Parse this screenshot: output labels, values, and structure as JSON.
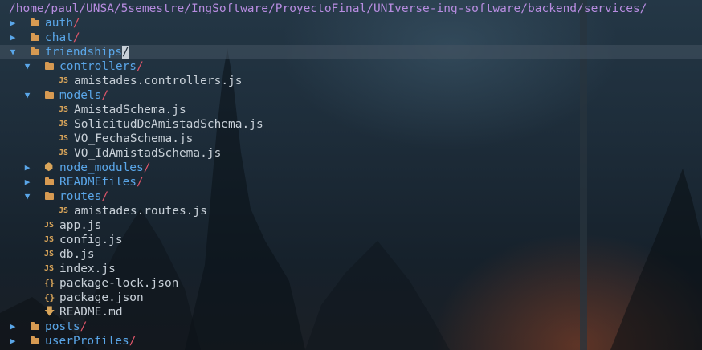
{
  "terminal": {
    "path": "/home/paul/UNSA/5semestre/IngSoftware/ProyectoFinal/UNIverse-ing-software/backend/services/",
    "tree": [
      {
        "name": "auth",
        "kind": "dir",
        "depth": 0,
        "expanded": false,
        "icon": "folder-icon"
      },
      {
        "name": "chat",
        "kind": "dir",
        "depth": 0,
        "expanded": false,
        "icon": "folder-icon"
      },
      {
        "name": "friendships",
        "kind": "dir",
        "depth": 0,
        "expanded": true,
        "icon": "folder-icon",
        "selected": true
      },
      {
        "name": "controllers",
        "kind": "dir",
        "depth": 1,
        "expanded": true,
        "icon": "folder-icon"
      },
      {
        "name": "amistades.controllers.js",
        "kind": "file",
        "depth": 2,
        "icon": "js-icon",
        "icon_text": "JS"
      },
      {
        "name": "models",
        "kind": "dir",
        "depth": 1,
        "expanded": true,
        "icon": "folder-icon"
      },
      {
        "name": "AmistadSchema.js",
        "kind": "file",
        "depth": 2,
        "icon": "js-icon",
        "icon_text": "JS"
      },
      {
        "name": "SolicitudDeAmistadSchema.js",
        "kind": "file",
        "depth": 2,
        "icon": "js-icon",
        "icon_text": "JS"
      },
      {
        "name": "VO_FechaSchema.js",
        "kind": "file",
        "depth": 2,
        "icon": "js-icon",
        "icon_text": "JS"
      },
      {
        "name": "VO_IdAmistadSchema.js",
        "kind": "file",
        "depth": 2,
        "icon": "js-icon",
        "icon_text": "JS"
      },
      {
        "name": "node_modules",
        "kind": "dir",
        "depth": 1,
        "expanded": false,
        "icon": "node-modules-icon",
        "icon_text": "⬢"
      },
      {
        "name": "READMEfiles",
        "kind": "dir",
        "depth": 1,
        "expanded": false,
        "icon": "folder-icon"
      },
      {
        "name": "routes",
        "kind": "dir",
        "depth": 1,
        "expanded": true,
        "icon": "folder-icon"
      },
      {
        "name": "amistades.routes.js",
        "kind": "file",
        "depth": 2,
        "icon": "js-icon",
        "icon_text": "JS"
      },
      {
        "name": "app.js",
        "kind": "file",
        "depth": 1,
        "icon": "js-icon",
        "icon_text": "JS"
      },
      {
        "name": "config.js",
        "kind": "file",
        "depth": 1,
        "icon": "js-icon",
        "icon_text": "JS"
      },
      {
        "name": "db.js",
        "kind": "file",
        "depth": 1,
        "icon": "js-icon",
        "icon_text": "JS"
      },
      {
        "name": "index.js",
        "kind": "file",
        "depth": 1,
        "icon": "js-icon",
        "icon_text": "JS"
      },
      {
        "name": "package-lock.json",
        "kind": "file",
        "depth": 1,
        "icon": "json-icon",
        "icon_text": "{}"
      },
      {
        "name": "package.json",
        "kind": "file",
        "depth": 1,
        "icon": "json-icon",
        "icon_text": "{}"
      },
      {
        "name": "README.md",
        "kind": "file",
        "depth": 1,
        "icon": "markdown-icon",
        "icon_text": "🡇"
      },
      {
        "name": "posts",
        "kind": "dir",
        "depth": 0,
        "expanded": false,
        "icon": "folder-icon"
      },
      {
        "name": "userProfiles",
        "kind": "dir",
        "depth": 0,
        "expanded": false,
        "icon": "folder-icon"
      }
    ],
    "dir_suffix": "/",
    "collapsed_glyph": "▶",
    "expanded_glyph": "▼"
  },
  "colors": {
    "path": "#b78ce0",
    "directory": "#5aa6e8",
    "file": "#c8d0d8",
    "slash": "#e0566a",
    "icon": "#d79a52"
  }
}
